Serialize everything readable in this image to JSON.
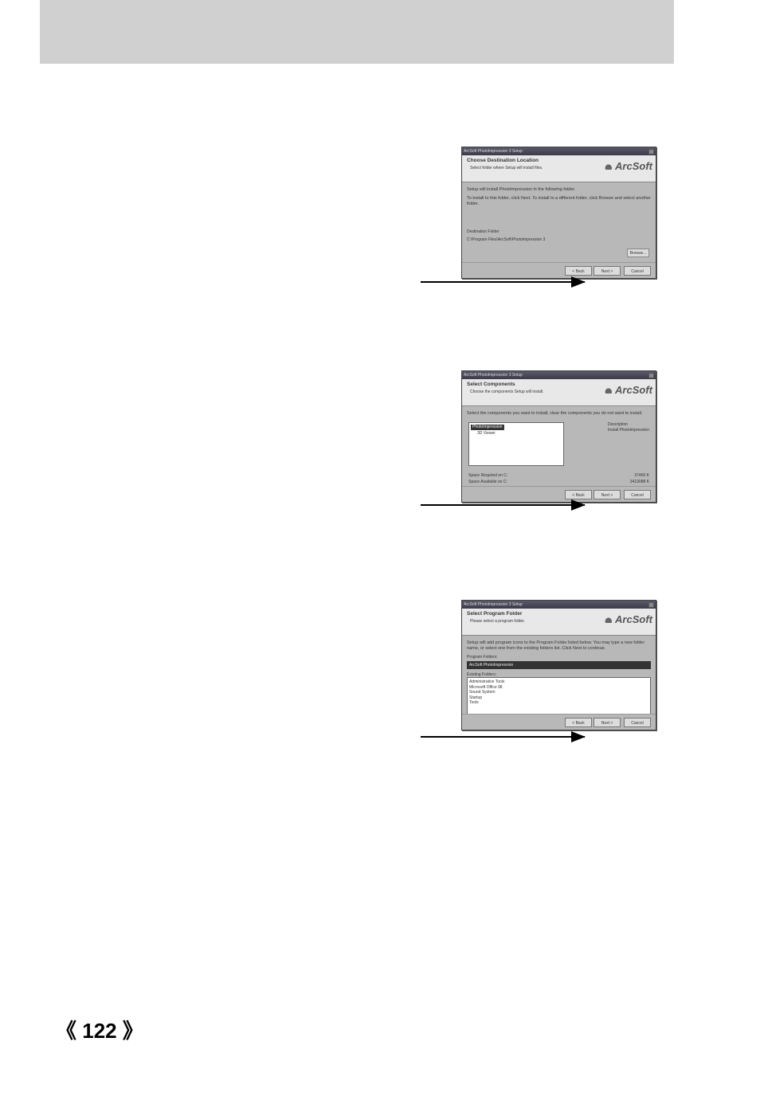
{
  "nav": {
    "prev": "《",
    "page": "122",
    "next": "》"
  },
  "dialogs": {
    "d1": {
      "titlebar": "ArcSoft PhotoImpression 3 Setup",
      "header_title": "Choose Destination Location",
      "header_sub": "Select folder where Setup will install files.",
      "logo": "ArcSoft",
      "body_line1": "Setup will install PhotoImpression in the following folder.",
      "body_line2": "To install to this folder, click Next. To install to a different folder, click Browse and select another folder.",
      "dest_label": "Destination Folder",
      "dest_path": "C:\\Program Files\\ArcSoft\\PhotoImpression 3",
      "browse": "Browse...",
      "back": "< Back",
      "next": "Next >",
      "cancel": "Cancel"
    },
    "d2": {
      "titlebar": "ArcSoft PhotoImpression 3 Setup",
      "header_title": "Select Components",
      "header_sub": "Choose the components Setup will install.",
      "body_line1": "Select the components you want to install, clear the components you do not want to install.",
      "logo": "ArcSoft",
      "comp_selected": "PhotoImpression",
      "comp_item2": "3D Viewer",
      "desc_label": "Description",
      "desc_text": "Install PhotoImpression",
      "space_req_label": "Space Required on  C:",
      "space_req_val": "37460 K",
      "space_avail_label": "Space Available on  C:",
      "space_avail_val": "3419088 K",
      "back": "< Back",
      "next": "Next >",
      "cancel": "Cancel"
    },
    "d3": {
      "titlebar": "ArcSoft PhotoImpression 3 Setup",
      "header_title": "Select Program Folder",
      "header_sub": "Please select a program folder.",
      "logo": "ArcSoft",
      "body_line1": "Setup will add program icons to the Program Folder listed below. You may type a new folder name, or select one from the existing folders list. Click Next to continue.",
      "prog_label": "Program Folders:",
      "prog_value": "ArcSoft PhotoImpression",
      "exist_label": "Existing Folders:",
      "exist_items": [
        "Administrative Tools",
        "Microsoft Office 98",
        "Sound System",
        "Startup",
        "Tools"
      ],
      "back": "< Back",
      "next": "Next >",
      "cancel": "Cancel"
    }
  }
}
